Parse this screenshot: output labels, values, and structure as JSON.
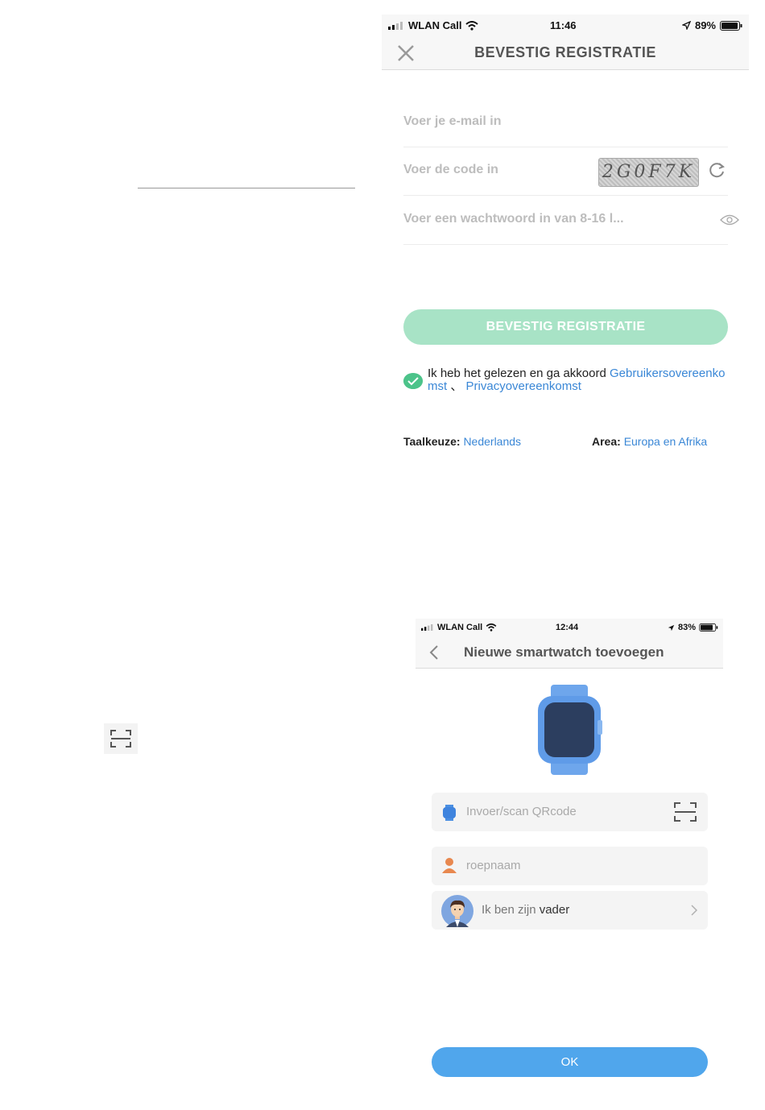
{
  "screen1": {
    "status": {
      "carrier": "WLAN Call",
      "time": "11:46",
      "battery": "89%"
    },
    "title": "BEVESTIG REGISTRATIE",
    "email_placeholder": "Voer je e-mail in",
    "code_placeholder": "Voer de code in",
    "captcha_text": "2G0F7K",
    "password_placeholder": "Voer een wachtwoord in van 8-16 l...",
    "confirm_button": "BEVESTIG REGISTRATIE",
    "agreement_text": "Ik heb het gelezen en ga akkoord ",
    "agreement_link1": "Gebruikersovereenkomst",
    "agreement_separator": " 、 ",
    "agreement_link2": "Privacyovereenkomst",
    "language_label": "Taalkeuze:",
    "language_value": "Nederlands",
    "area_label": "Area:",
    "area_value": "Europa en Afrika"
  },
  "screen2": {
    "status": {
      "carrier": "WLAN Call",
      "time": "12:44",
      "battery": "83%"
    },
    "title": "Nieuwe smartwatch toevoegen",
    "qr_placeholder": "Invoer/scan QRcode",
    "nickname_placeholder": "roepnaam",
    "relation_prefix": "Ik ben zijn ",
    "relation_value": "vader",
    "ok_button": "OK"
  },
  "colors": {
    "accent_green": "#4cc38a",
    "button_green_light": "#a8e3c6",
    "link_blue": "#3a87d6",
    "ok_blue": "#50a6ec",
    "watch_blue": "#6ea6ec"
  },
  "icons": [
    "signal-icon",
    "wifi-icon",
    "location-arrow-icon",
    "battery-icon",
    "close-icon",
    "refresh-icon",
    "eye-icon",
    "check-circle-icon",
    "back-chevron-icon",
    "smartwatch-icon",
    "scan-icon",
    "person-icon",
    "avatar-father",
    "chevron-right-icon"
  ]
}
